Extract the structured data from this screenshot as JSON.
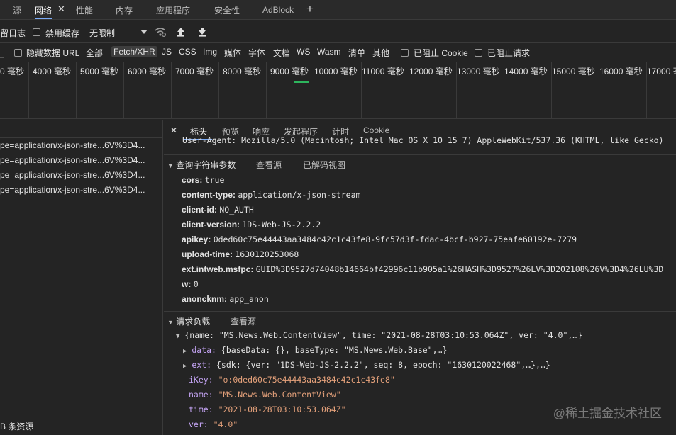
{
  "top_tabs": [
    {
      "label": "源"
    },
    {
      "label": "网络"
    },
    {
      "label": "性能"
    },
    {
      "label": "内存"
    },
    {
      "label": "应用程序"
    },
    {
      "label": "安全性"
    },
    {
      "label": "AdBlock"
    }
  ],
  "top_close": "✕",
  "top_plus": "+",
  "toolbar": {
    "preserve_log": "留日志",
    "disable_cache": "禁用缓存",
    "throttling": "无限制"
  },
  "filter": {
    "hide_data_urls": "隐藏数据 URL",
    "types": [
      "全部",
      "Fetch/XHR",
      "JS",
      "CSS",
      "Img",
      "媒体",
      "字体",
      "文档",
      "WS",
      "Wasm",
      "清单",
      "其他"
    ],
    "blocked_cookies": "已阻止 Cookie",
    "blocked_requests": "已阻止请求"
  },
  "timeline_ticks": [
    "0 毫秒",
    "4000 毫秒",
    "5000 毫秒",
    "6000 毫秒",
    "7000 毫秒",
    "8000 毫秒",
    "9000 毫秒",
    "10000 毫秒",
    "11000 毫秒",
    "12000 毫秒",
    "13000 毫秒",
    "14000 毫秒",
    "15000 毫秒",
    "16000 毫秒",
    "17000 毫秒"
  ],
  "requests": [
    "pe=application/x-json-stre...6V%3D4...",
    "pe=application/x-json-stre...6V%3D4...",
    "pe=application/x-json-stre...6V%3D4...",
    "pe=application/x-json-stre...6V%3D4..."
  ],
  "req_footer": "B 条资源",
  "detail_tabs": [
    "标头",
    "预览",
    "响应",
    "发起程序",
    "计时",
    "Cookie"
  ],
  "detail_close": "✕",
  "ua_line": "User-Agent: Mozilla/5.0 (Macintosh; Intel Mac OS X 10_15_7) AppleWebKit/537.36 (KHTML, like Gecko)",
  "query_section": {
    "title": "查询字符串参数",
    "view_source": "查看源",
    "view_decoded": "已解码视图",
    "params": [
      {
        "k": "cors:",
        "v": "true"
      },
      {
        "k": "content-type:",
        "v": "application/x-json-stream"
      },
      {
        "k": "client-id:",
        "v": "NO_AUTH"
      },
      {
        "k": "client-version:",
        "v": "1DS-Web-JS-2.2.2"
      },
      {
        "k": "apikey:",
        "v": "0ded60c75e44443aa3484c42c1c43fe8-9fc57d3f-fdac-4bcf-b927-75eafe60192e-7279"
      },
      {
        "k": "upload-time:",
        "v": "1630120253068"
      },
      {
        "k": "ext.intweb.msfpc:",
        "v": "GUID%3D9527d74048b14664bf42996c11b905a1%26HASH%3D9527%26LV%3D202108%26V%3D4%26LU%3D"
      },
      {
        "k": "w:",
        "v": "0"
      },
      {
        "k": "anoncknm:",
        "v": "app_anon"
      }
    ]
  },
  "payload_section": {
    "title": "请求负载",
    "view_source": "查看源",
    "root": "{name: \"MS.News.Web.ContentView\", time: \"2021-08-28T03:10:53.064Z\", ver: \"4.0\",…}",
    "data_key": "data:",
    "data_val": "{baseData: {}, baseType: \"MS.News.Web.Base\",…}",
    "ext_key": "ext:",
    "ext_val": "{sdk: {ver: \"1DS-Web-JS-2.2.2\", seq: 8, epoch: \"1630120022468\",…},…}",
    "fields": [
      {
        "k": "iKey:",
        "v": "\"o:0ded60c75e44443aa3484c42c1c43fe8\""
      },
      {
        "k": "name:",
        "v": "\"MS.News.Web.ContentView\""
      },
      {
        "k": "time:",
        "v": "\"2021-08-28T03:10:53.064Z\""
      },
      {
        "k": "ver:",
        "v": "\"4.0\""
      }
    ]
  },
  "watermark": "@稀土掘金技术社区"
}
